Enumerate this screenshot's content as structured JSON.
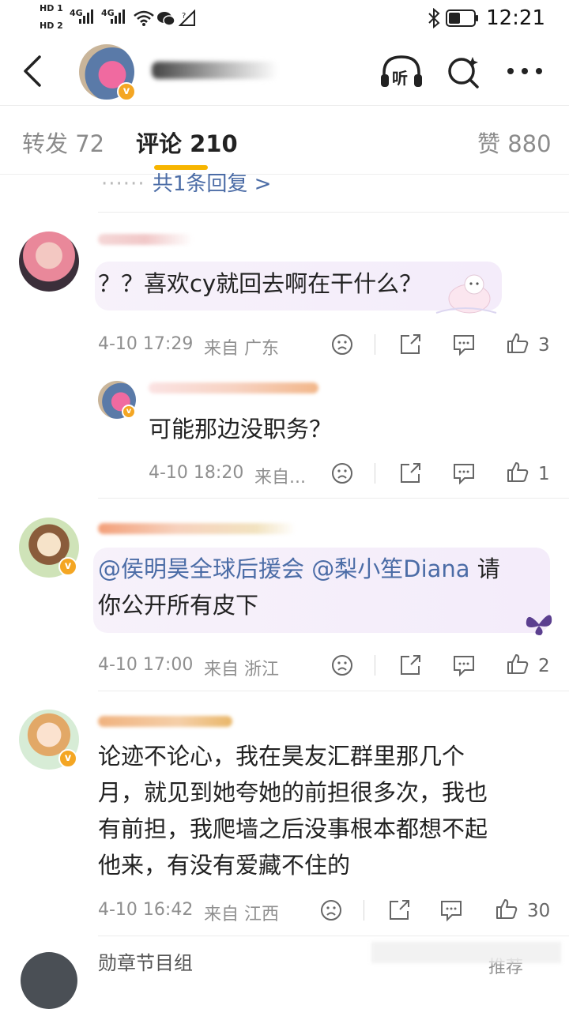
{
  "status_bar": {
    "sim1": "HD 1",
    "sim2": "HD 2",
    "net1": "4G",
    "net2": "4G",
    "time": "12:21"
  },
  "header": {
    "icons": [
      "back-arrow-icon",
      "listen-icon",
      "search-icon",
      "more-icon"
    ],
    "listen_label": "听"
  },
  "tabs": {
    "repost": "转发 72",
    "comments": "评论 210",
    "likes": "赞 880"
  },
  "more_replies": "共1条回复 >",
  "comments": [
    {
      "text": "？？喜欢cy就回去啊在干什么？",
      "date": "4-10 17:29",
      "source": "来自 广东",
      "likes": "3"
    },
    {
      "text": "可能那边没职务？",
      "date": "4-10 18:20",
      "source": "来自...",
      "likes": "1"
    },
    {
      "mention1": "@侯明昊全球后援会",
      "mention2": "@梨小笙Diana",
      "text_after": " 请",
      "text_line2": "你公开所有皮下",
      "date": "4-10 17:00",
      "source": "来自 浙江",
      "likes": "2"
    },
    {
      "line1": "论迹不论心，我在昊友汇群里那几个",
      "line2": "月，就见到她夸她的前担很多次，我也",
      "line3": "有前担，我爬墙之后没事根本都想不起",
      "line4": "他来，有没有爱藏不住的",
      "date": "4-10 16:42",
      "source": "来自 江西",
      "likes": "30"
    }
  ],
  "bottom_peek": {
    "name": "勋章节目组",
    "right": "推荐"
  },
  "colors": {
    "accent": "#f7b500",
    "link": "#4b6ca6",
    "meta": "#8f8f8f"
  }
}
